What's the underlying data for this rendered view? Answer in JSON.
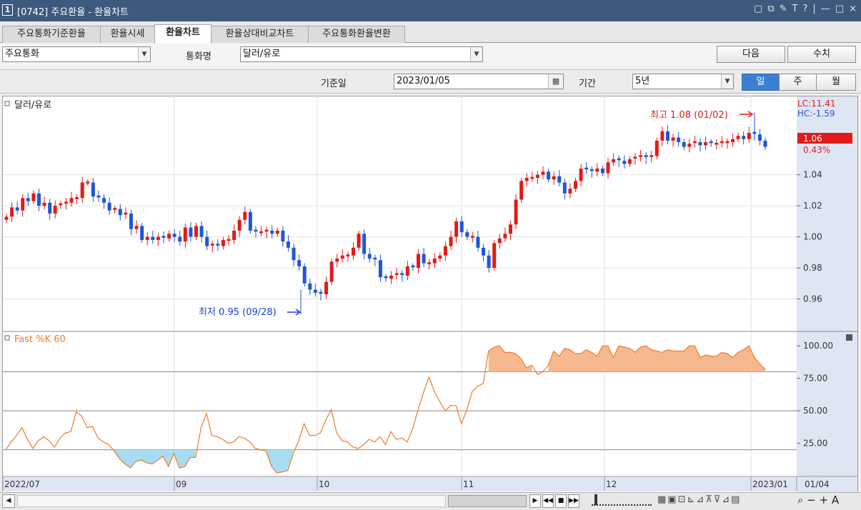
{
  "window": {
    "num": "1",
    "title": "[0742] 주요환율 - 환율차트",
    "icons": [
      "▢",
      "⧉",
      "✎",
      "T",
      "?",
      "|",
      "—",
      "□",
      "×"
    ]
  },
  "tabs": [
    {
      "label": "주요통화기준환율"
    },
    {
      "label": "환율시세"
    },
    {
      "label": "환율차트"
    },
    {
      "label": "환율상대비교차트"
    },
    {
      "label": "주요통화환율변환"
    }
  ],
  "toolbar": {
    "group_select": "주요통화",
    "currency_label": "통화명",
    "currency_select": "달러/유로",
    "next_btn": "다음",
    "value_btn": "수치"
  },
  "filter": {
    "date_label": "기준일",
    "date_value": "2023/01/05",
    "period_label": "기간",
    "period_value": "5년",
    "day": "일",
    "week": "주",
    "month": "월"
  },
  "chart": {
    "price_title": "달러/유로",
    "indicator_title": "Fast %K 60",
    "lc": "LC:11.41",
    "hc": "HC:-1.59",
    "cur_price": "1.06",
    "cur_pct": "0.43%",
    "high_annot": "최고 1.08 (01/02)",
    "low_annot": "최저 0.95 (09/28)",
    "y_ticks": [
      "1.04",
      "1.02",
      "1.00",
      "0.98",
      "0.96"
    ],
    "ind_ticks": [
      "100.00",
      "75.00",
      "50.00",
      "25.00"
    ],
    "x_labels": [
      "2022/07",
      "09",
      "10",
      "11",
      "12",
      "2023/01",
      "01/04"
    ]
  },
  "chart_data": [
    {
      "type": "candlestick",
      "title": "달러/유로",
      "ylim": [
        0.94,
        1.09
      ],
      "y_ticks": [
        1.04,
        1.02,
        1.0,
        0.98,
        0.96
      ],
      "closes": [
        1.013,
        1.019,
        1.017,
        1.025,
        1.023,
        1.028,
        1.02,
        1.022,
        1.015,
        1.02,
        1.021,
        1.022,
        1.025,
        1.025,
        1.035,
        1.035,
        1.026,
        1.025,
        1.022,
        1.017,
        1.018,
        1.014,
        1.015,
        1.005,
        1.007,
        0.998,
        1.0,
        0.998,
        1.0,
        0.999,
        1.002,
        1.0,
        0.997,
        1.006,
        1.0,
        1.007,
        1.0,
        0.994,
        0.995,
        0.994,
        0.998,
        0.998,
        1.004,
        1.011,
        1.016,
        1.004,
        1.003,
        1.003,
        1.004,
        1.002,
        1.004,
        0.997,
        0.993,
        0.985,
        0.981,
        0.97,
        0.966,
        0.964,
        0.963,
        0.971,
        0.984,
        0.986,
        0.988,
        0.988,
        0.993,
        1.002,
        0.989,
        0.986,
        0.985,
        0.974,
        0.973,
        0.975,
        0.976,
        0.975,
        0.981,
        0.98,
        0.989,
        0.983,
        0.983,
        0.986,
        0.988,
        0.994,
        1.0,
        1.01,
        1.003,
        1.0,
        1.0,
        0.993,
        0.988,
        0.98,
        0.996,
        0.999,
        1.002,
        1.008,
        1.024,
        1.036,
        1.038,
        1.038,
        1.04,
        1.042,
        1.037,
        1.039,
        1.035,
        1.028,
        1.031,
        1.036,
        1.044,
        1.043,
        1.042,
        1.044,
        1.041,
        1.048,
        1.05,
        1.049,
        1.047,
        1.05,
        1.051,
        1.052,
        1.051,
        1.052,
        1.062,
        1.068,
        1.062,
        1.064,
        1.061,
        1.058,
        1.06,
        1.061,
        1.059,
        1.061,
        1.06,
        1.06,
        1.061,
        1.061,
        1.063,
        1.065,
        1.063,
        1.067,
        1.066,
        1.062,
        1.058
      ],
      "high": 1.08,
      "high_date": "01/02",
      "low": 0.95,
      "low_date": "09/28"
    },
    {
      "type": "line",
      "title": "Fast %K 60",
      "ylim": [
        0,
        110
      ],
      "y_ticks": [
        100,
        75,
        50,
        25
      ],
      "reference_lines": [
        80,
        50,
        20
      ],
      "values": [
        20,
        26,
        31,
        37,
        28,
        21,
        27,
        30,
        27,
        22,
        29,
        33,
        34,
        49,
        46,
        37,
        38,
        29,
        26,
        24,
        19,
        13,
        9,
        6,
        11,
        12,
        10,
        9,
        12,
        15,
        7,
        17,
        6,
        7,
        14,
        14,
        37,
        48,
        31,
        30,
        28,
        25,
        26,
        30,
        29,
        26,
        21,
        20,
        19,
        7,
        2,
        3,
        4,
        17,
        27,
        40,
        31,
        31,
        33,
        43,
        51,
        33,
        27,
        26,
        22,
        21,
        24,
        28,
        26,
        30,
        24,
        34,
        28,
        29,
        26,
        36,
        51,
        64,
        76,
        65,
        57,
        50,
        54,
        54,
        40,
        51,
        65,
        69,
        71,
        96,
        99,
        100,
        95,
        95,
        94,
        90,
        83,
        85,
        78,
        80,
        85,
        96,
        92,
        98,
        97,
        94,
        94,
        97,
        95,
        92,
        100,
        100,
        91,
        100,
        99,
        98,
        95,
        99,
        100,
        97,
        96,
        95,
        97,
        96,
        96,
        96,
        100,
        100,
        91,
        93,
        92,
        92,
        95,
        94,
        91,
        95,
        97,
        100,
        91,
        86,
        82
      ]
    }
  ]
}
